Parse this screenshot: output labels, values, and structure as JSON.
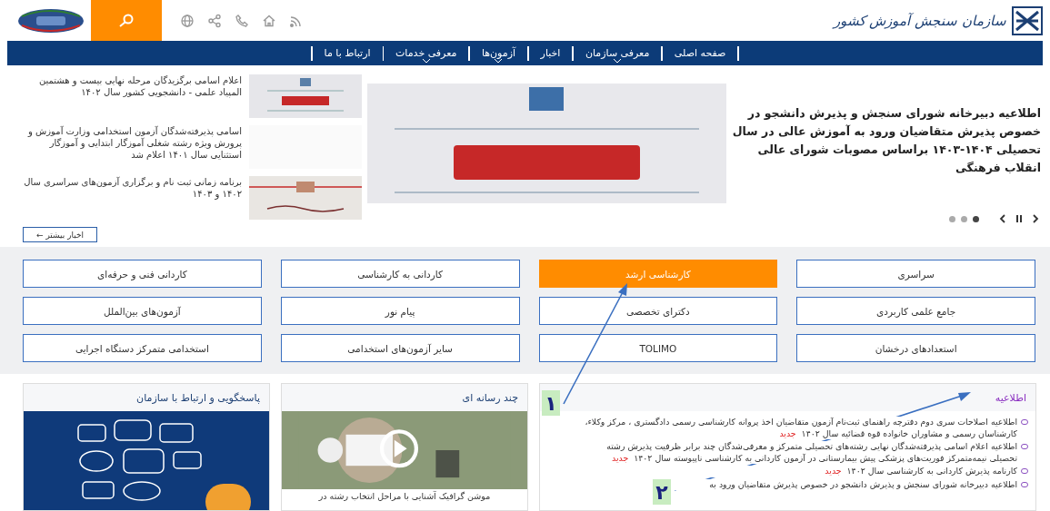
{
  "header": {
    "logo_text": "سازمان سنجش آموزش کشور"
  },
  "nav": [
    {
      "label": "صفحه اصلی",
      "has_menu": false
    },
    {
      "label": "معرفی سازمان",
      "has_menu": true
    },
    {
      "label": "اخبار",
      "has_menu": false
    },
    {
      "label": "آزمون‌ها",
      "has_menu": true
    },
    {
      "label": "معرفی خدمات",
      "has_menu": true
    },
    {
      "label": "ارتباط با ما",
      "has_menu": false
    }
  ],
  "slider": {
    "headline": "اطلاعیه دبیرخانه شورای سنجش و پذیرش دانشجو در خصوص پذیرش متقاضیان ورود به آموزش عالی در سال تحصیلی ۱۴۰۴-۱۴۰۳ براساس مصوبات شورای عالی انقلاب فرهنگی",
    "dots": [
      {
        "selected": true
      },
      {
        "selected": false
      },
      {
        "selected": false
      }
    ]
  },
  "news": [
    {
      "title": "اعلام اسامی برگزیدگان مرحله نهایی بیست و هشتمین المپیاد علمی - دانشجویی کشور سال ۱۴۰۲",
      "kind": "notice"
    },
    {
      "title": "اسامی پذیرفته‌شدگان آزمون استخدامی وزارت آموزش و پرورش ویژه رشته شغلی آموزگار ابتدایی و آموزگار استثنایی سال ۱۴۰۱ اعلام شد",
      "kind": "blank"
    },
    {
      "title": "برنامه زمانی ثبت نام و برگزاری آزمون‌های سراسری سال ۱۴۰۲ و ۱۴۰۳",
      "kind": "banner"
    }
  ],
  "more_news_button": "اخبار بیشتر ←",
  "exams": [
    {
      "label": "سراسری",
      "selected": false
    },
    {
      "label": "کارشناسی ارشد",
      "selected": true
    },
    {
      "label": "کاردانی به کارشناسی",
      "selected": false
    },
    {
      "label": "کاردانی فنی و حرفه‌ای",
      "selected": false
    },
    {
      "label": "جامع علمی کاربردی",
      "selected": false
    },
    {
      "label": "دکترای تخصصی",
      "selected": false
    },
    {
      "label": "پیام نور",
      "selected": false
    },
    {
      "label": "آزمون‌های بین‌الملل",
      "selected": false
    },
    {
      "label": "استعدادهای درخشان",
      "selected": false
    },
    {
      "label": "TOLIMO",
      "selected": false
    },
    {
      "label": "سایر آزمون‌های استخدامی",
      "selected": false
    },
    {
      "label": "استخدامی متمرکز دستگاه اجرایی",
      "selected": false
    }
  ],
  "notices_card": {
    "title": "اطلاعیه",
    "items": [
      {
        "text": "اطلاعیه اصلاحات سری دوم دفترچه راهنمای ثبت‌نام آزمون متقاضیان اخذ پروانه کارشناسی رسمی دادگستری ، مرکز وکلاء، کارشناسان رسمی و مشاوران خانواده قوه قضائیه سال ۱۴۰۲",
        "badge": "جدید"
      },
      {
        "text": "اطلاعیه اعلام اسامی پذیرفته‌شدگان نهایی رشته‌های تحصیلی متمرکز و معرفی‌شدگان چند برابر ظرفیت پذیرش رشته تحصیلی نیمه‌متمرکز فوریت‌های پزشکی پیش بیمارستانی در آزمون کاردانی به کارشناسی ناپیوسته سال ۱۴۰۲",
        "badge": "جدید"
      },
      {
        "text": "کارنامه پذیرش کاردانی به کارشناسی سال ۱۴۰۲",
        "badge": "جدید"
      },
      {
        "text": "اطلاعیه دبیرخانه شورای سنجش و پذیرش دانشجو در خصوص پذیرش متقاضیان ورود به"
      }
    ]
  },
  "media_card": {
    "title": "چند رسانه ای",
    "caption": "موشن گرافیک آشنایی با مراحل انتخاب رشته در"
  },
  "contact_card": {
    "title": "پاسخگویی و ارتباط با سازمان"
  },
  "annotations": [
    {
      "label": "۱"
    },
    {
      "label": "۲"
    }
  ]
}
